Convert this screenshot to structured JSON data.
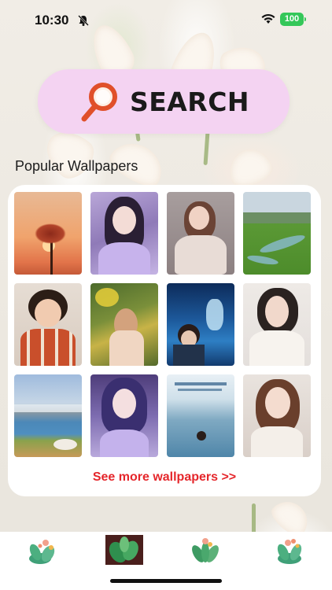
{
  "status_bar": {
    "time": "10:30",
    "battery": "100",
    "bell_icon": "bell-slash-icon",
    "wifi_icon": "wifi-icon"
  },
  "search": {
    "label": "SEARCH",
    "icon": "magnifier-icon"
  },
  "popular": {
    "title": "Popular Wallpapers",
    "see_more": "See more wallpapers >>",
    "thumbnails": [
      "sunset-tree-wallpaper",
      "purple-girl-wallpaper",
      "sitting-girl-wallpaper",
      "green-valley-wallpaper",
      "child-wallpaper",
      "flower-girl-wallpaper",
      "underwater-poster-wallpaper",
      "portrait-woman-wallpaper",
      "lake-landscape-wallpaper",
      "purple-hair-girl-wallpaper",
      "ocean-poster-wallpaper",
      "smiling-woman-wallpaper"
    ]
  },
  "tab_bar": {
    "tabs": [
      "floral-tab-1",
      "leaf-tab-selected",
      "floral-tab-3",
      "floral-tab-4"
    ],
    "selected_index": 1
  },
  "colors": {
    "search_bg": "#f4d3f2",
    "link_red": "#e5262b",
    "battery_green": "#34c759"
  }
}
